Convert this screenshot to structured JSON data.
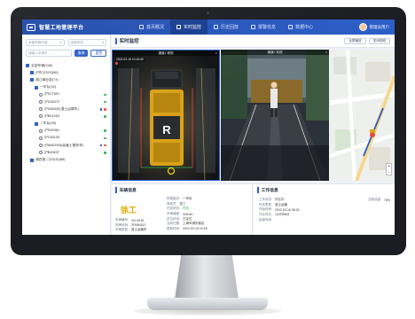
{
  "app": {
    "title": "智慧工地管理平台"
  },
  "nav": [
    {
      "label": "首页概况",
      "active": false
    },
    {
      "label": "实时监控",
      "active": true
    },
    {
      "label": "历史回放",
      "active": false
    },
    {
      "label": "报警信息",
      "active": false
    },
    {
      "label": "数据中心",
      "active": false
    }
  ],
  "user": {
    "name": "管理员用户"
  },
  "sidebar": {
    "filter1": "全部车辆分组",
    "filter2": "全部状态",
    "search_placeholder": "请输入车牌号",
    "search_label": "查询",
    "reset_label": "重置",
    "tree": [
      {
        "label": "全部车辆(248)",
        "level": 0,
        "kind": "group"
      },
      {
        "label": "沪东分公司(86)",
        "level": 1,
        "kind": "group"
      },
      {
        "label": "浦江事业部(74)",
        "level": 1,
        "kind": "group"
      },
      {
        "label": "一车队(32)",
        "level": 2,
        "kind": "group"
      },
      {
        "label": "沪D27891",
        "level": 3,
        "kind": "vehicle",
        "status": "on"
      },
      {
        "label": "沪D36472",
        "level": 3,
        "kind": "vehicle",
        "status": "on"
      },
      {
        "label": "沪A5K632(渣土运输车)",
        "level": 3,
        "kind": "vehicle",
        "status": "off",
        "camera": true
      },
      {
        "label": "沪B91263",
        "level": 3,
        "kind": "vehicle",
        "status": "on"
      },
      {
        "label": "二车队(28)",
        "level": 2,
        "kind": "group"
      },
      {
        "label": "沪D52981",
        "level": 3,
        "kind": "vehicle",
        "status": "on"
      },
      {
        "label": "沪C83126",
        "level": 3,
        "kind": "vehicle",
        "status": "on"
      },
      {
        "label": "沪A8D2W5(混凝土搅拌车)",
        "level": 3,
        "kind": "vehicle",
        "status": "off",
        "camera": true
      },
      {
        "label": "沪B40637",
        "level": 3,
        "kind": "vehicle",
        "status": "on"
      },
      {
        "label": "浦西第二分公司(88)",
        "level": 1,
        "kind": "group"
      }
    ]
  },
  "main": {
    "title": "实时监控",
    "action1": "全屏播放",
    "action2": "关闭视频",
    "videos": [
      {
        "label": "通道1 俯视",
        "timestamp": "2022-03-16 10:18:45"
      },
      {
        "label": "通道2 前视",
        "timestamp": ""
      },
      {
        "label": "",
        "timestamp": ""
      }
    ]
  },
  "vehicle_panel": {
    "title": "车辆信息",
    "logo_text": "徐工",
    "left": [
      {
        "k": "车辆编号:",
        "v": "XG-0918"
      },
      {
        "k": "车牌号码:",
        "v": "沪A5K632"
      },
      {
        "k": "车辆类型:",
        "v": "渣土运输车"
      }
    ],
    "right": [
      {
        "k": "所属组织:",
        "v": "一车队"
      },
      {
        "k": "驾驶员:",
        "v": "张三"
      },
      {
        "k": "在线状态:",
        "v": "在线",
        "green": true
      },
      {
        "k": "车辆速度:",
        "v": "32km/h"
      },
      {
        "k": "定位状态:",
        "v": "已定位"
      },
      {
        "k": "当前位置:",
        "v": "上海市浦东新区"
      },
      {
        "k": "更新时间:",
        "v": "2022-03-16 10:18"
      }
    ]
  },
  "work_panel": {
    "title": "工作信息",
    "rows": [
      {
        "k": "工作状态:",
        "v": "作业中",
        "k2": "当前油量:",
        "v2": "76%"
      },
      {
        "k": "任务类型:",
        "v": "渣土运输"
      },
      {
        "k": "开始时间:",
        "v": "2022-03-16 08:20"
      },
      {
        "k": "作业时长:",
        "v": "1小时58分"
      },
      {
        "k": "结束时间:",
        "v": ""
      }
    ]
  }
}
